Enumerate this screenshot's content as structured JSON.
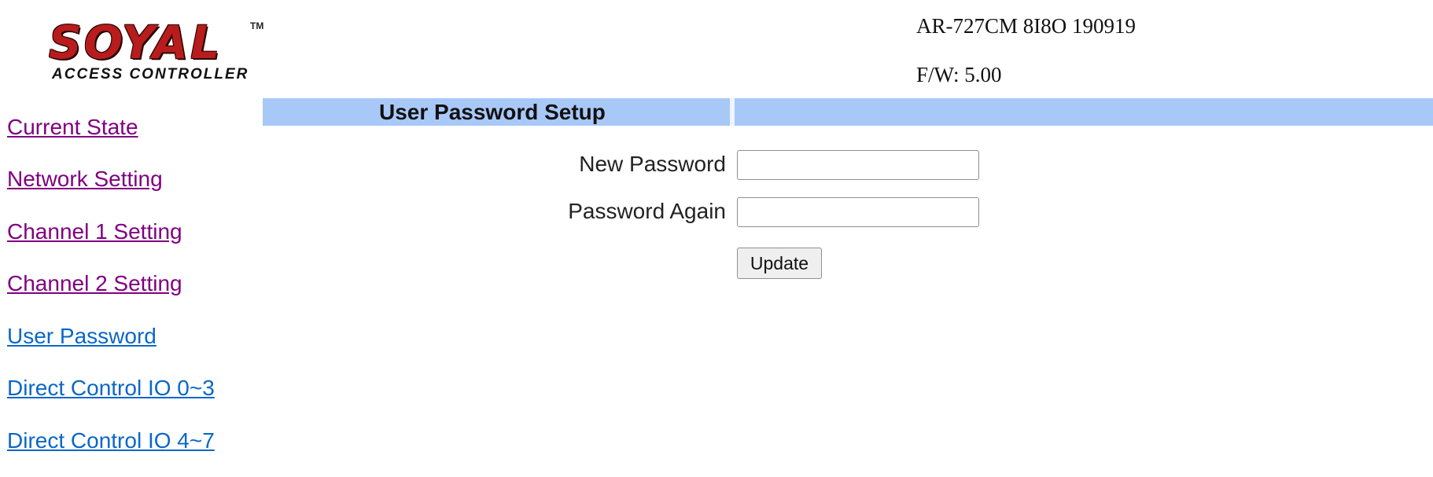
{
  "logo": {
    "wordmark": "SOYAL",
    "trademark": "TM",
    "subtitle": "ACCESS CONTROLLER",
    "color": "#b81c1c"
  },
  "device": {
    "model": "AR-727CM 8I8O 190919",
    "firmware": "F/W: 5.00"
  },
  "sidebar": {
    "items": [
      {
        "label": "Current State",
        "state": "visited"
      },
      {
        "label": "Network Setting",
        "state": "visited"
      },
      {
        "label": "Channel 1 Setting",
        "state": "visited"
      },
      {
        "label": "Channel 2 Setting",
        "state": "visited"
      },
      {
        "label": "User Password",
        "state": "unvisited"
      },
      {
        "label": "Direct Control IO 0~3",
        "state": "unvisited"
      },
      {
        "label": "Direct Control IO 4~7",
        "state": "unvisited"
      }
    ],
    "visited_color": "#800080",
    "unvisited_color": "#0b67c8"
  },
  "header": {
    "title": "User Password Setup",
    "bar_color": "#a8c8f8"
  },
  "form": {
    "new_password": {
      "label": "New Password",
      "value": ""
    },
    "password_again": {
      "label": "Password Again",
      "value": ""
    },
    "submit_label": "Update"
  }
}
